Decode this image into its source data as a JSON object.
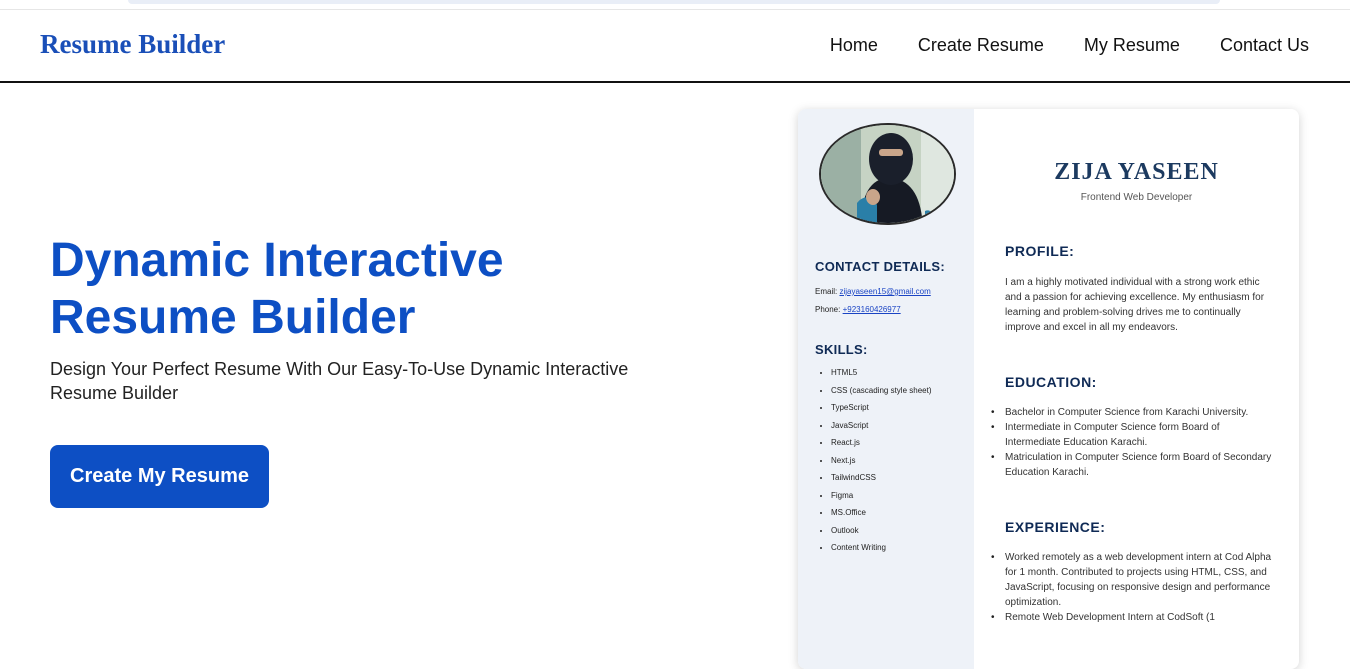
{
  "nav": {
    "brand": "Resume Builder",
    "links": [
      "Home",
      "Create Resume",
      "My Resume",
      "Contact Us"
    ]
  },
  "hero": {
    "title_line1": "Dynamic Interactive",
    "title_line2": "Resume Builder",
    "subtitle": "Design Your Perfect Resume With Our Easy-To-Use Dynamic Interactive Resume Builder",
    "cta_label": "Create My Resume"
  },
  "resume": {
    "name": "ZIJA YASEEN",
    "role": "Frontend Web Developer",
    "contact_heading": "CONTACT DETAILS:",
    "email_label": "Email:",
    "email": "zijayaseen15@gmail.com",
    "phone_label": "Phone:",
    "phone": "+923160426977",
    "skills_heading": "SKILLS:",
    "skills": [
      "HTML5",
      "CSS (cascading style sheet)",
      "TypeScript",
      "JavaScript",
      "React.js",
      "Next.js",
      "TailwindCSS",
      "Figma",
      "MS.Office",
      "Outlook",
      "Content Writing"
    ],
    "profile_heading": "PROFILE:",
    "profile_text": "I am a highly motivated individual with a strong work ethic and a passion for achieving excellence. My enthusiasm for learning and problem-solving drives me to continually improve and excel in all my endeavors.",
    "education_heading": "EDUCATION:",
    "education": [
      "Bachelor in Computer Science from Karachi University.",
      "Intermediate in Computer Science form Board of Intermediate Education Karachi.",
      "Matriculation in Computer Science form Board of Secondary Education Karachi."
    ],
    "experience_heading": "EXPERIENCE:",
    "experience": [
      "Worked remotely as a web development intern at Cod Alpha for 1 month. Contributed to projects using HTML, CSS, and JavaScript, focusing on responsive design and performance optimization.",
      "Remote Web Development Intern at CodSoft (1"
    ]
  },
  "colors": {
    "brand": "#1a4fb8",
    "primary": "#0d4fc4",
    "resume_heading": "#0f2a55",
    "sidebar_bg": "#eef2f8"
  }
}
